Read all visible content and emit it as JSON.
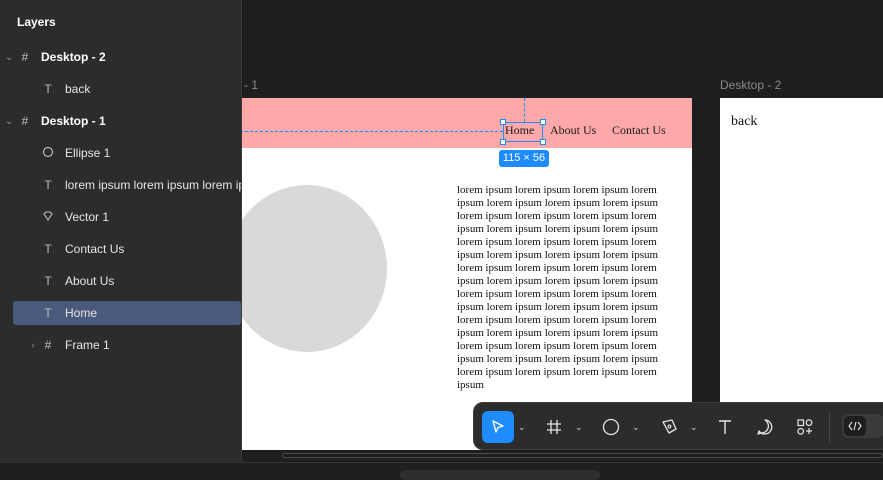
{
  "layers_panel": {
    "title": "Layers",
    "items": [
      {
        "label": "Desktop - 2",
        "type": "frame",
        "expanded": true,
        "icon": "frame-hash-icon"
      },
      {
        "label": "back",
        "type": "text",
        "icon": "text-icon"
      },
      {
        "label": "Desktop - 1",
        "type": "frame",
        "expanded": true,
        "icon": "frame-hash-icon"
      },
      {
        "label": "Ellipse 1",
        "type": "ellipse",
        "icon": "ellipse-icon"
      },
      {
        "label": "lorem ipsum lorem ipsum lorem ip",
        "type": "text",
        "icon": "text-icon"
      },
      {
        "label": "Vector 1",
        "type": "vector",
        "icon": "vector-icon"
      },
      {
        "label": "Contact Us",
        "type": "text",
        "icon": "text-icon"
      },
      {
        "label": "About Us",
        "type": "text",
        "icon": "text-icon"
      },
      {
        "label": "Home",
        "type": "text",
        "icon": "text-icon",
        "selected": true
      },
      {
        "label": "Frame 1",
        "type": "frame",
        "expanded": false,
        "icon": "frame-hash-icon"
      }
    ]
  },
  "canvas": {
    "frame1_label": "- 1",
    "frame2_label": "Desktop - 2",
    "nav": {
      "home": "Home",
      "about": "About Us",
      "contact": "Contact Us"
    },
    "lorem_text": "lorem ipsum  lorem ipsum lorem ipsum lorem ipsum lorem ipsum  lorem ipsum lorem ipsum lorem ipsum lorem ipsum lorem ipsum  lorem ipsum lorem ipsum lorem ipsum lorem ipsum lorem ipsum  lorem ipsum lorem ipsum lorem ipsum lorem ipsum lorem ipsum  lorem ipsum lorem ipsum lorem ipsum lorem ipsum lorem ipsum lorem ipsum lorem ipsum  lorem ipsum lorem ipsum lorem ipsum lorem ipsum lorem ipsum lorem ipsum lorem ipsum lorem ipsum lorem ipsum  lorem ipsum lorem ipsum lorem ipsum lorem ipsum lorem ipsum lorem ipsum  lorem ipsum lorem ipsum lorem ipsum lorem ipsum lorem ipsum lorem ipsum  lorem ipsum lorem ipsum lorem ipsum lorem ipsum lorem ipsum",
    "back_text": "back",
    "selection_size": "115 × 56"
  },
  "colors": {
    "navbar": "#fda9a9",
    "accent": "#1e8bff",
    "ellipse": "#d9d9d9",
    "panel_bg": "#2c2c2c",
    "selected_row": "#4a5a7c"
  },
  "toolbar": {
    "tools": [
      "move-tool",
      "frame-tool",
      "ellipse-tool",
      "pen-tool",
      "text-tool",
      "comment-tool",
      "components-tool",
      "dev-mode-toggle"
    ]
  }
}
